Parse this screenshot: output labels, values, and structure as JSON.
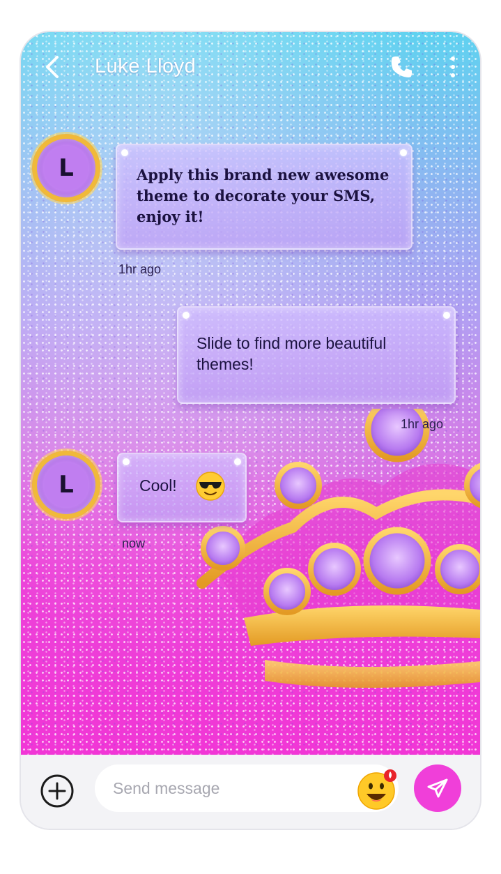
{
  "header": {
    "contact_name": "Luke Lloyd"
  },
  "messages": [
    {
      "sender": "incoming",
      "avatar_letter": "L",
      "text": "Apply this brand new awesome theme to decorate your SMS, enjoy it!",
      "time": "1hr ago"
    },
    {
      "sender": "outgoing",
      "text": "Slide to find more beautiful themes!",
      "time": "1hr ago"
    },
    {
      "sender": "incoming",
      "avatar_letter": "L",
      "text": "Cool!",
      "emoji": "sunglasses-face",
      "time": "now"
    }
  ],
  "composer": {
    "placeholder": "Send message"
  },
  "colors": {
    "accent": "#f03fd9",
    "avatar_ring": "#f0b93a",
    "bubble": "#c9b4f7"
  }
}
